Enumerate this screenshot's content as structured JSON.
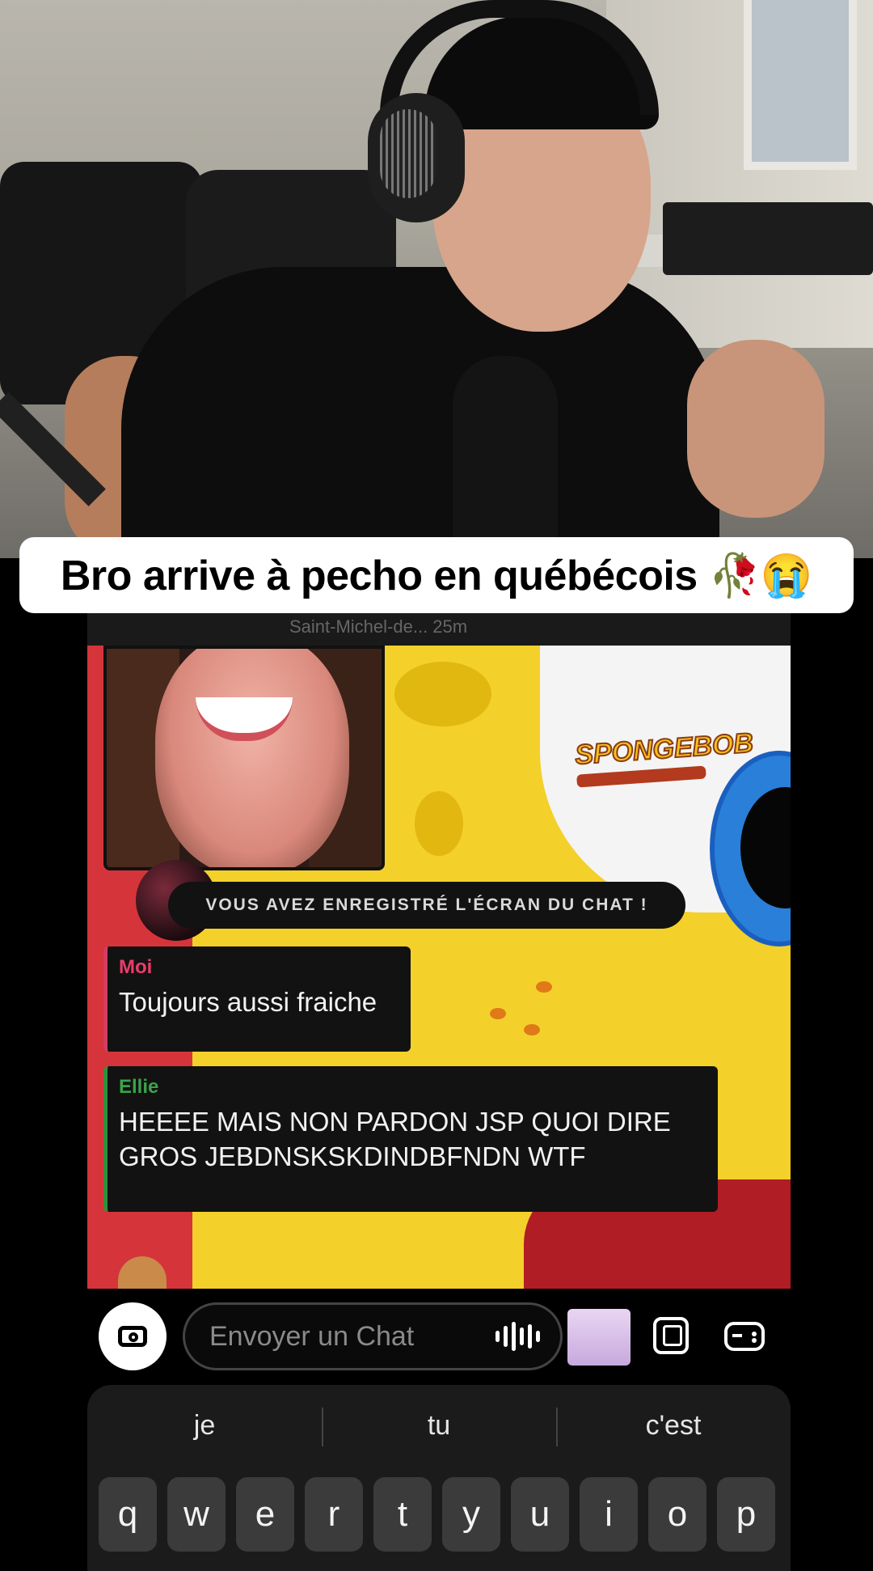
{
  "caption": {
    "text": "Bro arrive à pecho en québécois 🥀😭"
  },
  "chat": {
    "header_text": "Saint-Michel-de...  25m",
    "logo_text": "SPONGEBOB",
    "screenshot_notice": "VOUS AVEZ ENREGISTRÉ L'ÉCRAN DU CHAT !",
    "messages": [
      {
        "sender": "Moi",
        "text": "Toujours aussi fraiche",
        "sender_color": "#e93d6b"
      },
      {
        "sender": "Ellie",
        "text": "HEEEE MAIS NON PARDON JSP QUOI DIRE GROS JEBDNSKSKDINDBFNDN WTF",
        "sender_color": "#3aa34a"
      }
    ]
  },
  "input_bar": {
    "placeholder": "Envoyer un Chat",
    "icons": [
      "camera-icon",
      "voice-icon",
      "bitmoji-icon",
      "sticker-icon",
      "game-controller-icon"
    ]
  },
  "keyboard": {
    "suggestions": [
      "je",
      "tu",
      "c'est"
    ],
    "row1": [
      "q",
      "w",
      "e",
      "r",
      "t",
      "y",
      "u",
      "i",
      "o",
      "p"
    ]
  }
}
